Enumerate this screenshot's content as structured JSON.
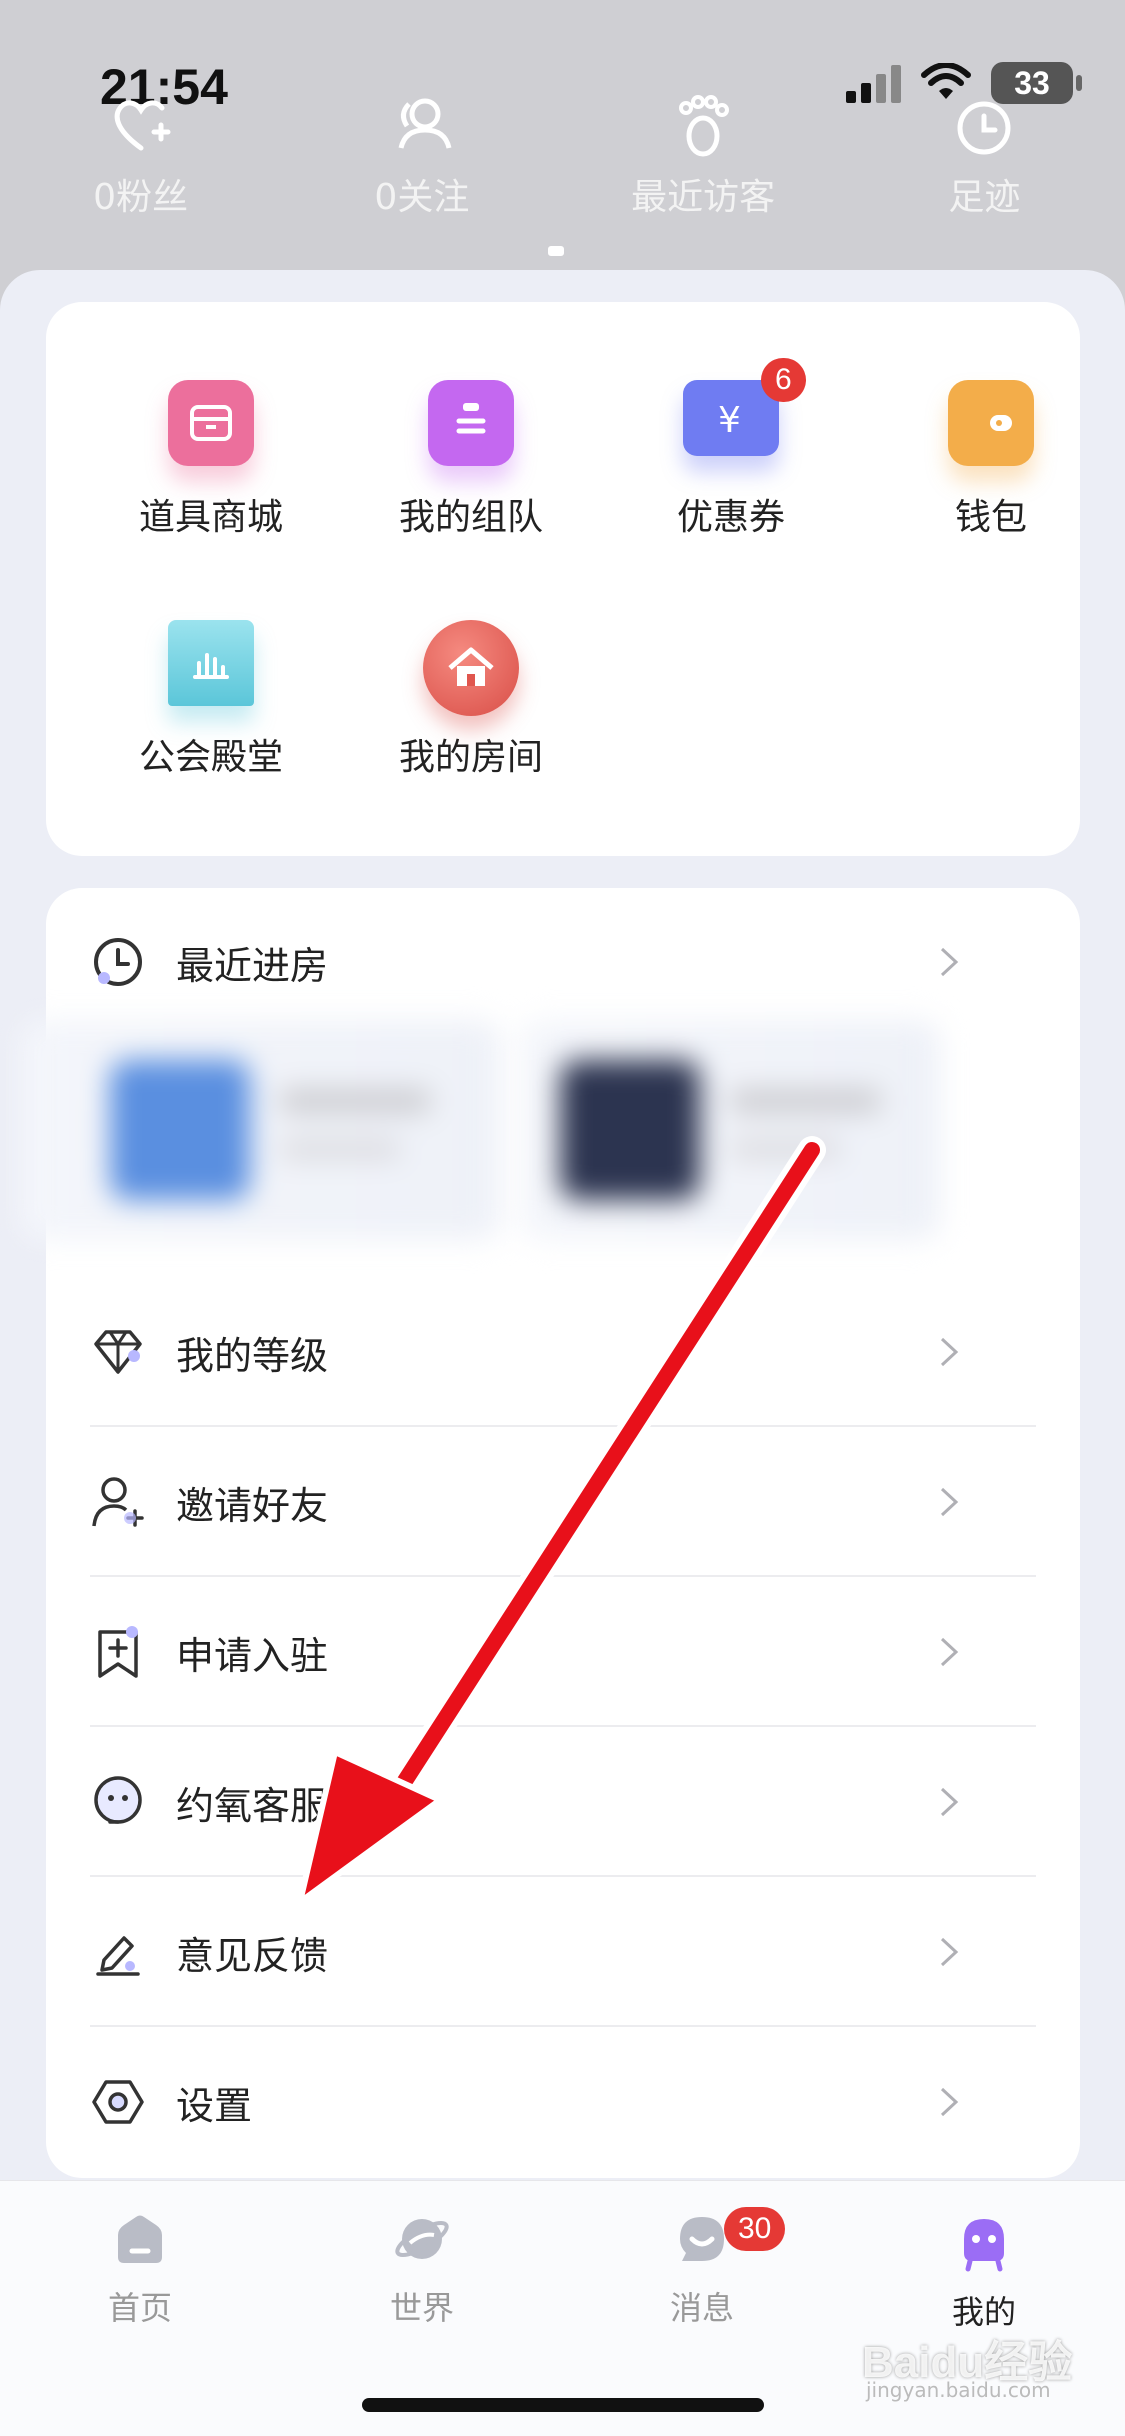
{
  "status": {
    "time": "21:54",
    "battery": "33"
  },
  "stats": [
    {
      "label": "0粉丝",
      "icon": "heart-plus-icon"
    },
    {
      "label": "0关注",
      "icon": "people-icon"
    },
    {
      "label": "最近访客",
      "icon": "footprint-icon"
    },
    {
      "label": "足迹",
      "icon": "clock-icon"
    }
  ],
  "services": [
    {
      "label": "道具商城",
      "icon": "shop-icon",
      "color": "#ec6f9c"
    },
    {
      "label": "我的组队",
      "icon": "clipboard-icon",
      "color": "#c468f0"
    },
    {
      "label": "优惠券",
      "icon": "coupon-icon",
      "color": "#6f7cf2",
      "badge": "6"
    },
    {
      "label": "钱包",
      "icon": "wallet-icon",
      "color": "#f3ad4a"
    },
    {
      "label": "公会殿堂",
      "icon": "guild-icon",
      "color": "#5bc6d9"
    },
    {
      "label": "我的房间",
      "icon": "house-icon",
      "color": "#e8625a"
    }
  ],
  "menu": {
    "recent": "最近进房",
    "items": [
      {
        "label": "我的等级",
        "icon": "diamond-icon"
      },
      {
        "label": "邀请好友",
        "icon": "add-person-icon"
      },
      {
        "label": "申请入驻",
        "icon": "bookmark-plus-icon"
      },
      {
        "label": "约氧客服",
        "icon": "customer-service-icon"
      },
      {
        "label": "意见反馈",
        "icon": "edit-icon"
      },
      {
        "label": "设置",
        "icon": "settings-hex-icon"
      }
    ]
  },
  "tabs": [
    {
      "label": "首页",
      "icon": "home-icon"
    },
    {
      "label": "世界",
      "icon": "planet-icon"
    },
    {
      "label": "消息",
      "icon": "chat-icon",
      "badge": "30"
    },
    {
      "label": "我的",
      "icon": "profile-icon",
      "active": true
    }
  ],
  "colors": {
    "accent": "#9b6df5",
    "badge": "#e53935",
    "arrow": "#e8101a"
  },
  "watermark": {
    "line1": "Baidu经验",
    "line2": "jingyan.baidu.com"
  }
}
